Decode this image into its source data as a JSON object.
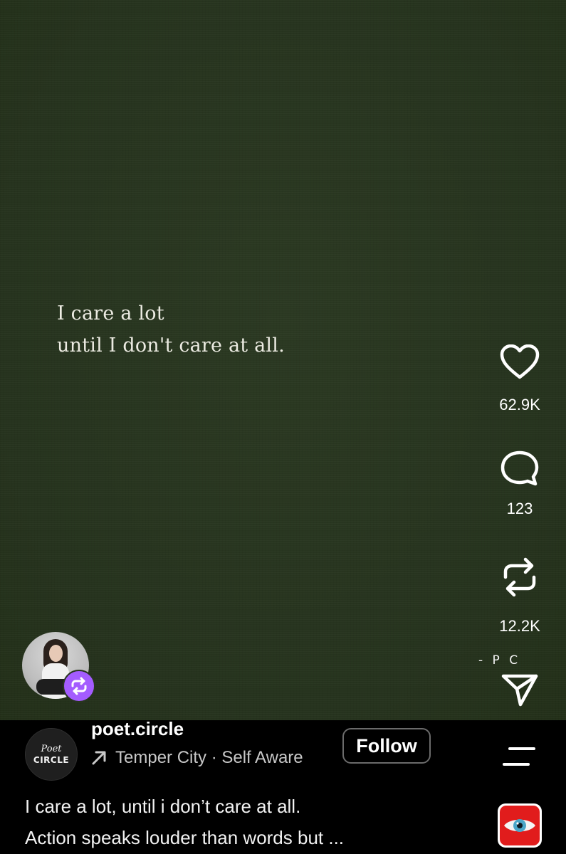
{
  "post": {
    "quote_lines": [
      "I care a lot",
      "until I don't care at all."
    ],
    "signature": "- P C"
  },
  "actions": {
    "like": {
      "icon": "heart-icon",
      "count": "62.9K"
    },
    "comment": {
      "icon": "comment-icon",
      "count": "123"
    },
    "repost": {
      "icon": "repost-icon",
      "count": "12.2K"
    },
    "share": {
      "icon": "send-icon"
    }
  },
  "account": {
    "logo_line1": "Poet",
    "logo_line2": "CIRCLE",
    "username": "poet.circle",
    "location_text": "Temper City · Self Aware",
    "follow_label": "Follow"
  },
  "caption": {
    "line1": "I care a lot, until i don’t care at all.",
    "line2": "Action speaks louder than words but ..."
  },
  "colors": {
    "background": "#28351f",
    "remix_badge": "#a45cff",
    "audio_thumb": "#e11c1c"
  }
}
